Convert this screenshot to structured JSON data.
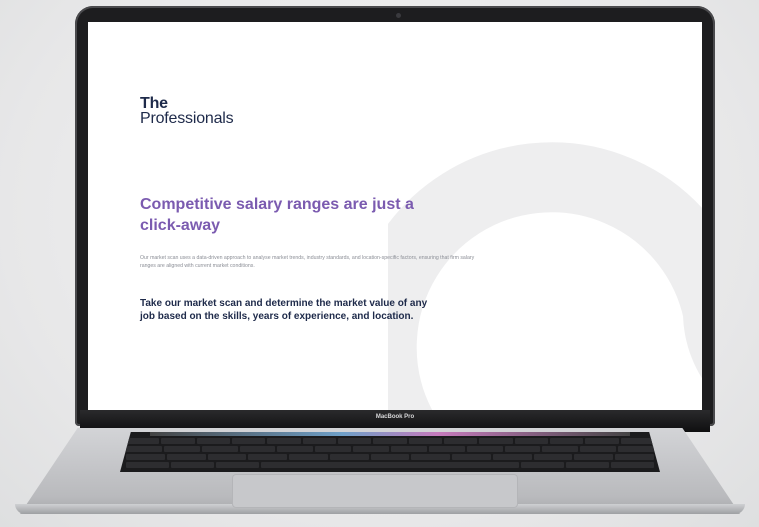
{
  "device": {
    "label": "MacBook Pro"
  },
  "page": {
    "logo_line1": "The",
    "logo_line2": "Professionals",
    "headline": "Competitive salary ranges are just a click-away",
    "body": "Our market scan uses a data-driven approach to analyse market trends, industry standards, and location-specific factors, ensuring that firm salary ranges are aligned with current market conditions.",
    "cta": "Take our market scan and determine the market value of any job based on the skills, years of experience, and location."
  },
  "colors": {
    "headline": "#7b5bb0",
    "navy": "#1e2a4a",
    "watermark": "#eeeeef"
  }
}
